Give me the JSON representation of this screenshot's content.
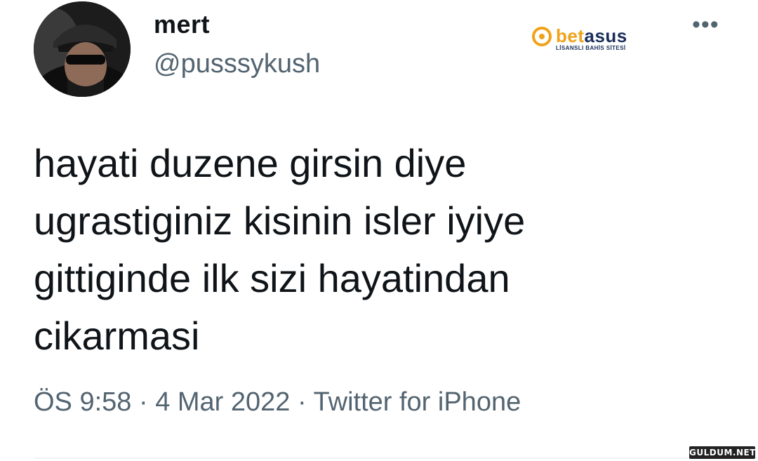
{
  "tweet": {
    "display_name": "mert",
    "handle": "@pusssykush",
    "text_lines": [
      "hayati duzene girsin diye",
      "ugrastiginiz kisinin isler iyiye",
      "gittiginde ilk sizi hayatindan",
      "cikarmasi"
    ],
    "time": "ÖS 9:58",
    "separator": "·",
    "date": "4 Mar 2022",
    "source": "Twitter for iPhone",
    "more_label": "•••"
  },
  "watermark": {
    "brand_part1": "bet",
    "brand_part2": "asus",
    "tagline": "LİSANSLI BAHİS SİTESİ",
    "site": "GULDUM.NET"
  },
  "colors": {
    "text_primary": "#0f1419",
    "text_secondary": "#536471",
    "logo_orange": "#f0a21a",
    "logo_navy": "#1a2e5a"
  }
}
